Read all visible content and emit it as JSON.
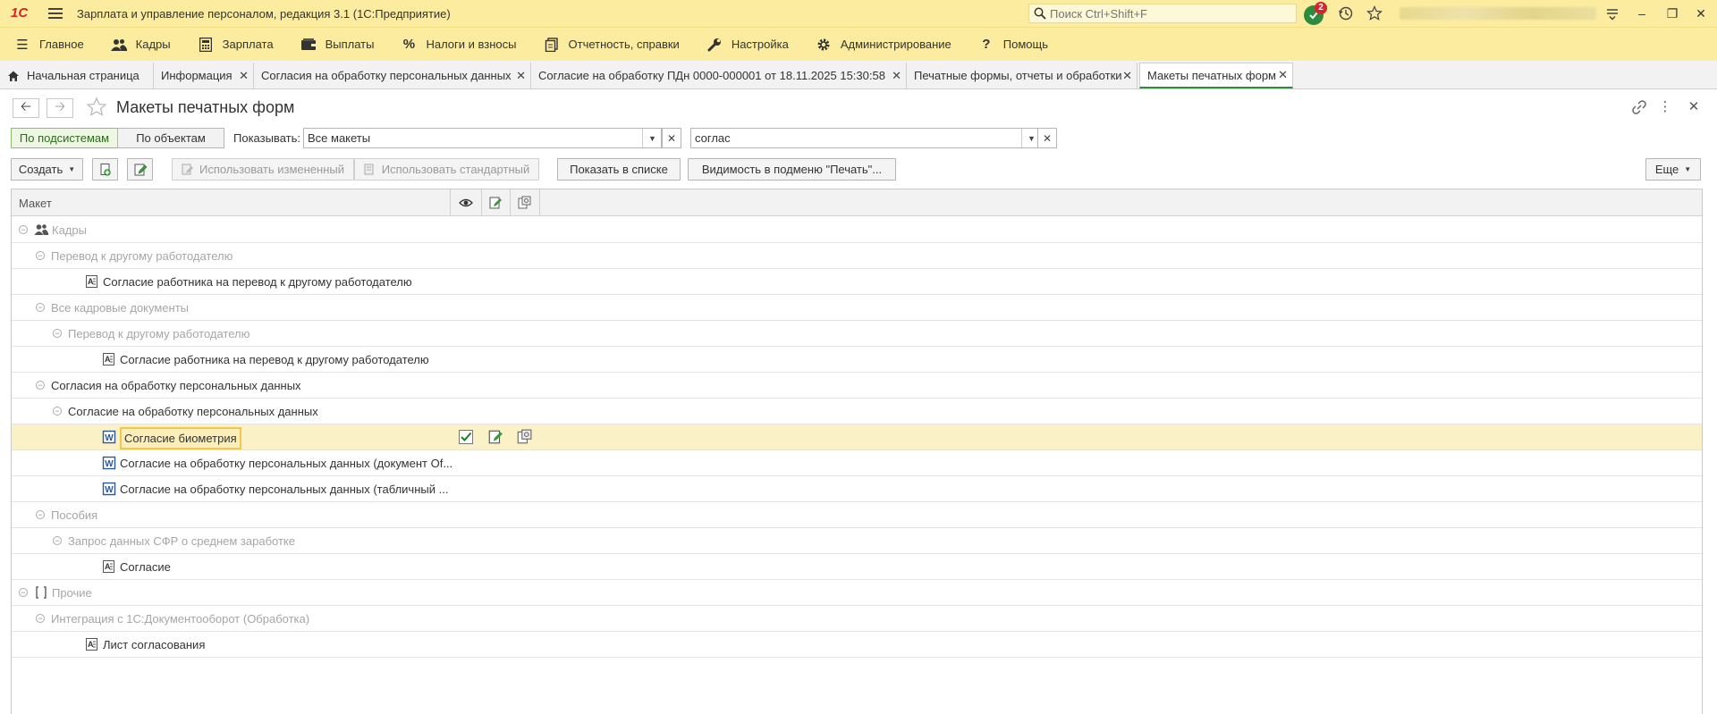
{
  "window": {
    "title": "Зарплата и управление персоналом, редакция 3.1  (1С:Предприятие)",
    "logo": "1С",
    "search_placeholder": "Поиск Ctrl+Shift+F",
    "notifications_count": "2"
  },
  "menu": [
    {
      "label": "Главное",
      "icon": "menu-lines-icon"
    },
    {
      "label": "Кадры",
      "icon": "people-icon"
    },
    {
      "label": "Зарплата",
      "icon": "calculator-icon"
    },
    {
      "label": "Выплаты",
      "icon": "wallet-icon"
    },
    {
      "label": "Налоги и взносы",
      "icon": "percent-icon"
    },
    {
      "label": "Отчетность, справки",
      "icon": "reports-icon"
    },
    {
      "label": "Настройка",
      "icon": "wrench-icon"
    },
    {
      "label": "Администрирование",
      "icon": "gear-icon"
    },
    {
      "label": "Помощь",
      "icon": "question-icon"
    }
  ],
  "tabs": [
    {
      "label": "Начальная страница"
    },
    {
      "label": "Информация"
    },
    {
      "label": "Согласия на обработку персональных данных"
    },
    {
      "label": "Согласие на обработку ПДн 0000-000001 от 18.11.2025 15:30:58"
    },
    {
      "label": "Печатные формы, отчеты и обработки"
    },
    {
      "label": "Макеты печатных форм"
    }
  ],
  "form": {
    "title": "Макеты печатных форм",
    "mode_subsystems": "По подсистемам",
    "mode_objects": "По объектам",
    "show_label": "Показывать:",
    "show_value": "Все макеты",
    "search_value": "соглас"
  },
  "toolbar": {
    "create": "Создать",
    "use_modified": "Использовать измененный",
    "use_standard": "Использовать стандартный",
    "show_in_list": "Показать в списке",
    "visibility": "Видимость в подменю \"Печать\"...",
    "more": "Еще"
  },
  "table": {
    "column": "Макет",
    "rows": [
      {
        "text": "Кадры",
        "level": 0,
        "style": "gray",
        "icon": "people-icon",
        "toggle": true
      },
      {
        "text": "Перевод к другому работодателю",
        "level": 1,
        "style": "gray",
        "toggle": true
      },
      {
        "text": "Согласие работника на перевод к другому работодателю",
        "level": 2,
        "style": "dark",
        "icon": "template-icon"
      },
      {
        "text": "Все кадровые документы",
        "level": 1,
        "style": "gray",
        "toggle": true
      },
      {
        "text": "Перевод к другому работодателю",
        "level": 2,
        "style": "gray",
        "toggle": true
      },
      {
        "text": "Согласие работника на перевод к другому работодателю",
        "level": 3,
        "style": "dark",
        "icon": "template-icon"
      },
      {
        "text": "Согласия на обработку персональных данных",
        "level": 1,
        "style": "dark",
        "toggle": true
      },
      {
        "text": "Согласие на обработку персональных данных",
        "level": 2,
        "style": "dark",
        "toggle": true
      },
      {
        "text": "Согласие биометрия",
        "level": 3,
        "style": "selected",
        "icon": "word-icon",
        "selected": true
      },
      {
        "text": "Согласие на обработку персональных данных (документ Of...",
        "level": 3,
        "style": "dark",
        "icon": "word-icon"
      },
      {
        "text": "Согласие на обработку персональных данных (табличный ...",
        "level": 3,
        "style": "dark",
        "icon": "word-icon"
      },
      {
        "text": "Пособия",
        "level": 1,
        "style": "gray",
        "toggle": true
      },
      {
        "text": "Запрос данных СФР о среднем заработке",
        "level": 2,
        "style": "gray",
        "toggle": true
      },
      {
        "text": "Согласие",
        "level": 3,
        "style": "dark",
        "icon": "template-icon"
      },
      {
        "text": "Прочие",
        "level": 0,
        "style": "gray",
        "icon": "bracket-icon",
        "toggle": true
      },
      {
        "text": "Интеграция с 1С:Документооборот (Обработка)",
        "level": 1,
        "style": "gray",
        "toggle": true
      },
      {
        "text": "Лист согласования",
        "level": 2,
        "style": "dark",
        "icon": "template-icon"
      }
    ]
  },
  "colors": {
    "chrome": "#fbeca0",
    "accent_green": "#2e8b3e",
    "selection": "#fbf1c7"
  }
}
